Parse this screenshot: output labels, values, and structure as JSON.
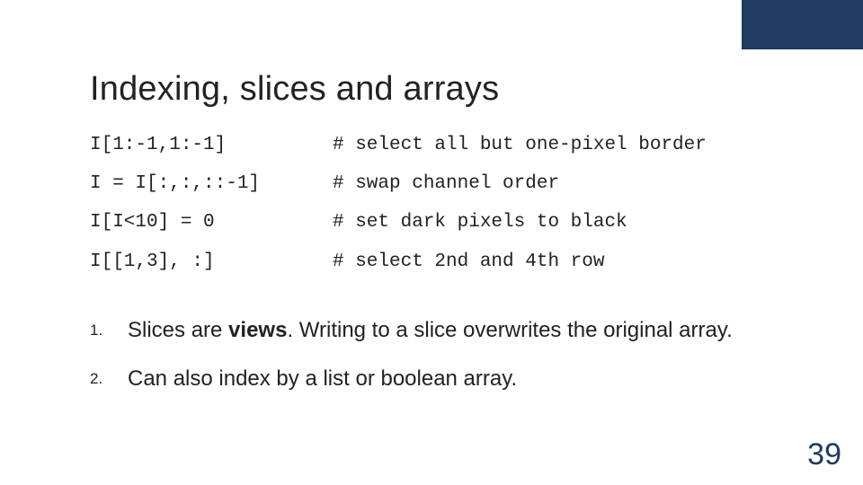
{
  "title": "Indexing, slices and arrays",
  "code": [
    {
      "lhs": "I[1:-1,1:-1]",
      "rhs": "# select all but one-pixel border"
    },
    {
      "lhs": "I = I[:,:,::-1]",
      "rhs": "# swap channel order"
    },
    {
      "lhs": "I[I<10] = 0",
      "rhs": "# set dark pixels to black"
    },
    {
      "lhs": "I[[1,3], :]",
      "rhs": "# select 2nd and 4th row"
    }
  ],
  "notes": [
    {
      "num": "1.",
      "prefix": "Slices are ",
      "strong": "views",
      "suffix": ". Writing to a slice overwrites the original array."
    },
    {
      "num": "2.",
      "prefix": "Can also index by a list or boolean array.",
      "strong": "",
      "suffix": ""
    }
  ],
  "page_number": "39"
}
